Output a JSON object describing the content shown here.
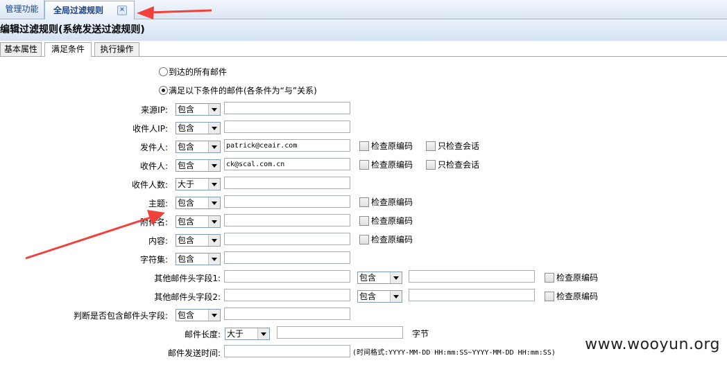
{
  "tabs": {
    "inactive": "管理功能",
    "active": "全局过滤规则"
  },
  "title": "编辑过滤规则(系统发送过滤规则)",
  "subtabs": [
    "基本属性",
    "满足条件",
    "执行操作"
  ],
  "radios": {
    "all": "到达的所有邮件",
    "cond": "满足以下条件的邮件(各条件为“与”关系)"
  },
  "rows": [
    {
      "label": "来源IP:",
      "op": "包含",
      "value": ""
    },
    {
      "label": "收件人IP:",
      "op": "包含",
      "value": ""
    },
    {
      "label": "发件人:",
      "op": "包含",
      "value": "patrick@ceair.com",
      "cb1": "检查原编码",
      "cb2": "只检查会话"
    },
    {
      "label": "收件人:",
      "op": "包含",
      "value": "ck@scal.com.cn",
      "cb1": "检查原编码",
      "cb2": "只检查会话"
    },
    {
      "label": "收件人数:",
      "op": "大于",
      "value": ""
    },
    {
      "label": "主题:",
      "op": "包含",
      "value": "",
      "cb1": "检查原编码"
    },
    {
      "label": "附件名:",
      "op": "包含",
      "value": "",
      "cb1": "检查原编码"
    },
    {
      "label": "内容:",
      "op": "包含",
      "value": "",
      "cb1": "检查原编码"
    },
    {
      "label": "字符集:",
      "op": "包含",
      "value": ""
    }
  ],
  "header_rows": [
    {
      "label": "其他邮件头字段1:",
      "op": "包含",
      "cb": "检查原编码"
    },
    {
      "label": "其他邮件头字段2:",
      "op": "包含",
      "cb": "检查原编码"
    }
  ],
  "judge": {
    "label": "判断是否包含邮件头字段:",
    "op": "包含"
  },
  "length": {
    "label": "邮件长度:",
    "op": "大于",
    "unit": "字节"
  },
  "sendtime": {
    "label": "邮件发送时间:",
    "hint": "(时间格式:YYYY-MM-DD HH:mm:SS~YYYY-MM-DD HH:mm:SS)"
  },
  "watermark": "www.wooyun.org",
  "colors": {
    "arrow": "#f2403a",
    "tab_text": "#15428b"
  }
}
